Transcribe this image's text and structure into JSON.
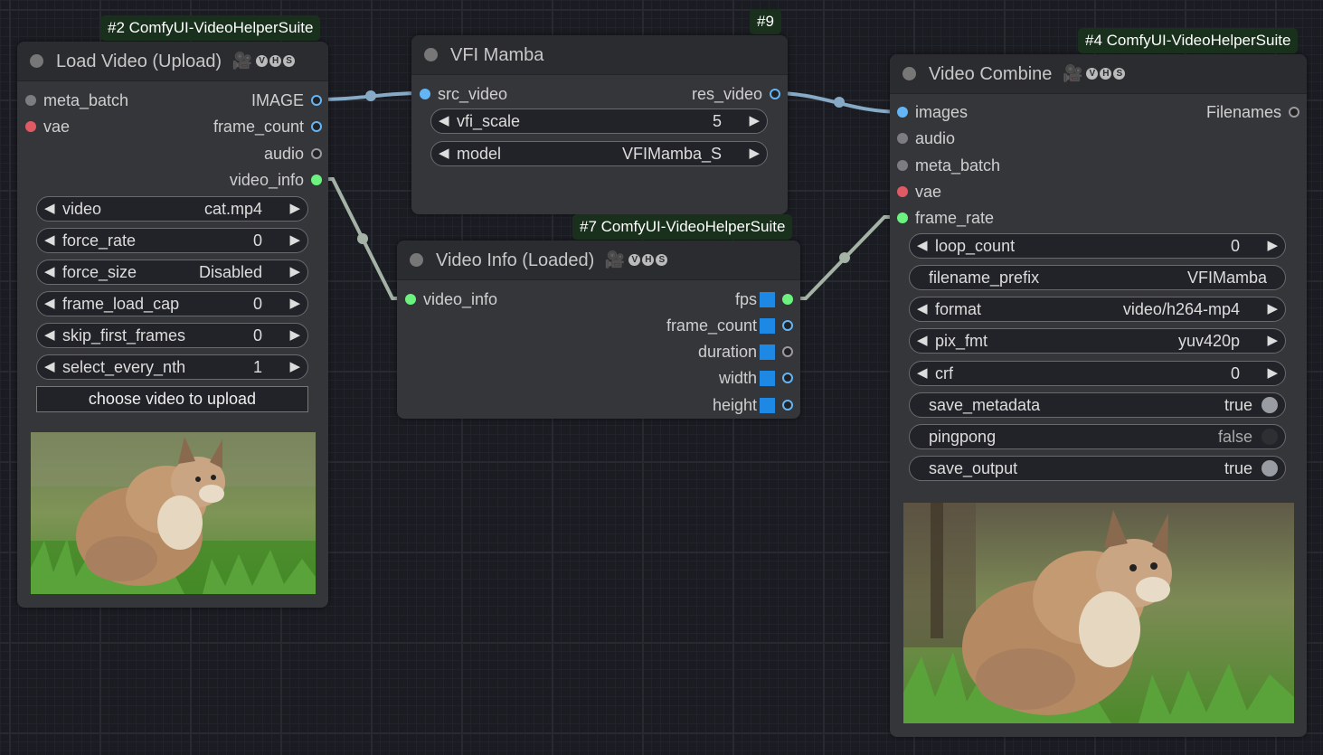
{
  "load_video": {
    "badge": "#2 ComfyUI-VideoHelperSuite",
    "title": "Load Video (Upload)",
    "inputs": [
      "meta_batch",
      "vae"
    ],
    "outputs": [
      "IMAGE",
      "frame_count",
      "audio",
      "video_info"
    ],
    "widgets": {
      "video": {
        "name": "video",
        "value": "cat.mp4"
      },
      "force_rate": {
        "name": "force_rate",
        "value": "0"
      },
      "force_size": {
        "name": "force_size",
        "value": "Disabled"
      },
      "frame_load_cap": {
        "name": "frame_load_cap",
        "value": "0"
      },
      "skip_first_frames": {
        "name": "skip_first_frames",
        "value": "0"
      },
      "select_every_nth": {
        "name": "select_every_nth",
        "value": "1"
      }
    },
    "upload_button": "choose video to upload",
    "preview": "lynx sitting in grass"
  },
  "vfi_mamba": {
    "badge": "#9",
    "title": "VFI Mamba",
    "inputs": [
      "src_video"
    ],
    "outputs": [
      "res_video"
    ],
    "widgets": {
      "vfi_scale": {
        "name": "vfi_scale",
        "value": "5"
      },
      "model": {
        "name": "model",
        "value": "VFIMamba_S"
      }
    }
  },
  "video_info": {
    "badge": "#7 ComfyUI-VideoHelperSuite",
    "title": "Video Info (Loaded)",
    "inputs": [
      "video_info"
    ],
    "outputs": [
      "fps",
      "frame_count",
      "duration",
      "width",
      "height"
    ]
  },
  "video_combine": {
    "badge": "#4 ComfyUI-VideoHelperSuite",
    "title": "Video Combine",
    "inputs": [
      "images",
      "audio",
      "meta_batch",
      "vae",
      "frame_rate"
    ],
    "outputs": [
      "Filenames"
    ],
    "widgets": {
      "loop_count": {
        "name": "loop_count",
        "value": "0"
      },
      "filename_prefix": {
        "name": "filename_prefix",
        "value": "VFIMamba"
      },
      "format": {
        "name": "format",
        "value": "video/h264-mp4"
      },
      "pix_fmt": {
        "name": "pix_fmt",
        "value": "yuv420p"
      },
      "crf": {
        "name": "crf",
        "value": "0"
      },
      "save_metadata": {
        "name": "save_metadata",
        "value": "true"
      },
      "pingpong": {
        "name": "pingpong",
        "value": "false"
      },
      "save_output": {
        "name": "save_output",
        "value": "true"
      }
    },
    "preview": "lynx sitting in grass"
  },
  "vhs_letters": [
    "V",
    "H",
    "S"
  ],
  "colors": {
    "image_link": "#87aac6",
    "info_link": "#a4b3a6",
    "badge_bg": "#19301c",
    "node_bg": "#35363a",
    "canvas_bg": "#1a1c22"
  }
}
